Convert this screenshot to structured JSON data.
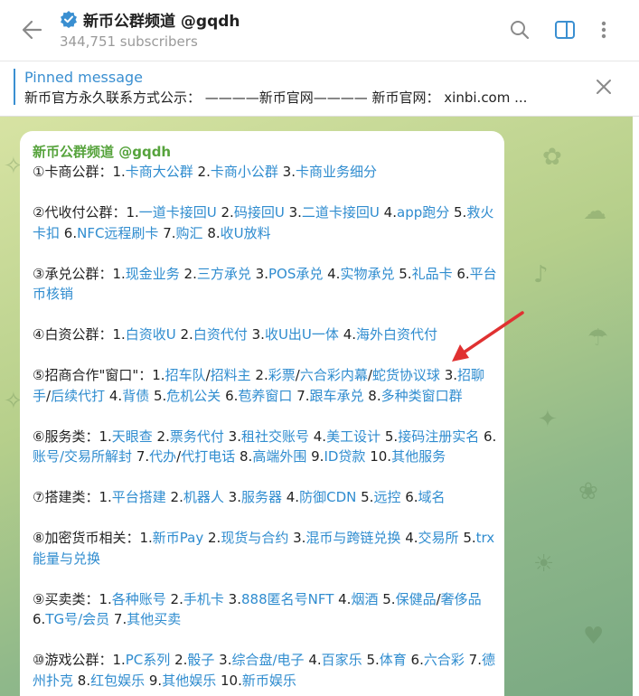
{
  "header": {
    "title": "新币公群频道 @gqdh",
    "subscribers": "344,751 subscribers"
  },
  "pinned": {
    "label": "Pinned message",
    "text": "新币官方永久联系方式公示：  ————新币官网———— 新币官网：  xinbi.com ..."
  },
  "message": {
    "sender": "新币公群频道 @gqdh",
    "paragraphs": [
      [
        {
          "t": "①卡商公群：1."
        },
        {
          "l": "卡商大公群"
        },
        {
          "t": " 2."
        },
        {
          "l": "卡商小公群"
        },
        {
          "t": " 3."
        },
        {
          "l": "卡商业务细分"
        }
      ],
      [
        {
          "t": "②代收付公群：1."
        },
        {
          "l": "一道卡接回U"
        },
        {
          "t": " 2."
        },
        {
          "l": "码接回U"
        },
        {
          "t": " 3."
        },
        {
          "l": "二道卡接回U"
        },
        {
          "t": " 4."
        },
        {
          "l": "app跑分"
        },
        {
          "t": " 5."
        },
        {
          "l": "救火卡扣"
        },
        {
          "t": " 6."
        },
        {
          "l": "NFC远程刷卡"
        },
        {
          "t": " 7."
        },
        {
          "l": "购汇"
        },
        {
          "t": " 8."
        },
        {
          "l": "收U放料"
        }
      ],
      [
        {
          "t": "③承兑公群：1."
        },
        {
          "l": "现金业务"
        },
        {
          "t": " 2."
        },
        {
          "l": "三方承兑"
        },
        {
          "t": " 3."
        },
        {
          "l": "POS承兑"
        },
        {
          "t": " 4."
        },
        {
          "l": "实物承兑"
        },
        {
          "t": " 5."
        },
        {
          "l": "礼品卡"
        },
        {
          "t": " 6."
        },
        {
          "l": "平台币核销"
        }
      ],
      [
        {
          "t": "④白资公群：1."
        },
        {
          "l": "白资收U"
        },
        {
          "t": " 2."
        },
        {
          "l": "白资代付"
        },
        {
          "t": " 3."
        },
        {
          "l": "收U出U一体"
        },
        {
          "t": " 4."
        },
        {
          "l": "海外白资代付"
        }
      ],
      [
        {
          "t": "⑤招商合作\"窗口\"：1."
        },
        {
          "l": "招车队"
        },
        {
          "t": "/"
        },
        {
          "l": "招料主"
        },
        {
          "t": " 2."
        },
        {
          "l": "彩票"
        },
        {
          "t": "/"
        },
        {
          "l": "六合彩内幕"
        },
        {
          "t": "/"
        },
        {
          "l": "蛇货协议球"
        },
        {
          "t": " 3."
        },
        {
          "l": "招聊手"
        },
        {
          "t": "/"
        },
        {
          "l": "后续代打"
        },
        {
          "t": " 4."
        },
        {
          "l": "背债"
        },
        {
          "t": " 5."
        },
        {
          "l": "危机公关"
        },
        {
          "t": " 6."
        },
        {
          "l": "苞养窗口"
        },
        {
          "t": " 7."
        },
        {
          "l": "跟车承兑"
        },
        {
          "t": " 8."
        },
        {
          "l": "多种类窗口群"
        }
      ],
      [
        {
          "t": "⑥服务类：1."
        },
        {
          "l": "天眼查"
        },
        {
          "t": " 2."
        },
        {
          "l": "票务代付"
        },
        {
          "t": " 3."
        },
        {
          "l": "租社交账号"
        },
        {
          "t": " 4."
        },
        {
          "l": "美工设计"
        },
        {
          "t": " 5."
        },
        {
          "l": "接码注册实名"
        },
        {
          "t": " 6."
        },
        {
          "l": "账号/交易所解封"
        },
        {
          "t": " 7."
        },
        {
          "l": "代办"
        },
        {
          "t": "/"
        },
        {
          "l": "代打电话"
        },
        {
          "t": " 8."
        },
        {
          "l": "高端外围"
        },
        {
          "t": " 9."
        },
        {
          "l": "ID贷款"
        },
        {
          "t": " 10."
        },
        {
          "l": "其他服务"
        }
      ],
      [
        {
          "t": "⑦搭建类：1."
        },
        {
          "l": "平台搭建"
        },
        {
          "t": " 2."
        },
        {
          "l": "机器人"
        },
        {
          "t": " 3."
        },
        {
          "l": "服务器"
        },
        {
          "t": " 4."
        },
        {
          "l": "防御CDN"
        },
        {
          "t": " 5."
        },
        {
          "l": "远控"
        },
        {
          "t": " 6."
        },
        {
          "l": "域名"
        }
      ],
      [
        {
          "t": "⑧加密货币相关：1."
        },
        {
          "l": "新币Pay"
        },
        {
          "t": " 2."
        },
        {
          "l": "现货与合约"
        },
        {
          "t": " 3."
        },
        {
          "l": "混币与跨链兑换"
        },
        {
          "t": " 4."
        },
        {
          "l": "交易所"
        },
        {
          "t": " 5."
        },
        {
          "l": "trx能量与兑换"
        }
      ],
      [
        {
          "t": "⑨买卖类：1."
        },
        {
          "l": "各种账号"
        },
        {
          "t": " 2."
        },
        {
          "l": "手机卡"
        },
        {
          "t": " 3."
        },
        {
          "l": "888匿名号NFT"
        },
        {
          "t": " 4."
        },
        {
          "l": "烟酒"
        },
        {
          "t": " 5."
        },
        {
          "l": "保健品"
        },
        {
          "t": "/"
        },
        {
          "l": "奢侈品"
        },
        {
          "t": " 6."
        },
        {
          "l": "TG号/会员"
        },
        {
          "t": " 7."
        },
        {
          "l": "其他买卖"
        }
      ],
      [
        {
          "t": "⑩游戏公群：1."
        },
        {
          "l": "PC系列"
        },
        {
          "t": " 2."
        },
        {
          "l": "骰子"
        },
        {
          "t": " 3."
        },
        {
          "l": "综合盘/电子"
        },
        {
          "t": " 4."
        },
        {
          "l": "百家乐"
        },
        {
          "t": " 5."
        },
        {
          "l": "体育"
        },
        {
          "t": " 6."
        },
        {
          "l": "六合彩"
        },
        {
          "t": " 7."
        },
        {
          "l": "德州扑克"
        },
        {
          "t": " 8."
        },
        {
          "l": "红包娱乐"
        },
        {
          "t": " 9."
        },
        {
          "l": "其他娱乐"
        },
        {
          "t": " 10."
        },
        {
          "l": "新币娱乐"
        }
      ]
    ]
  },
  "colors": {
    "link": "#2f8ccf",
    "sender": "#56a33c",
    "accent": "#3a8fd1",
    "arrow": "#e03131"
  },
  "icons": [
    "back-arrow-icon",
    "verified-badge-icon",
    "search-icon",
    "sidebar-toggle-icon",
    "more-vertical-icon",
    "close-icon"
  ]
}
